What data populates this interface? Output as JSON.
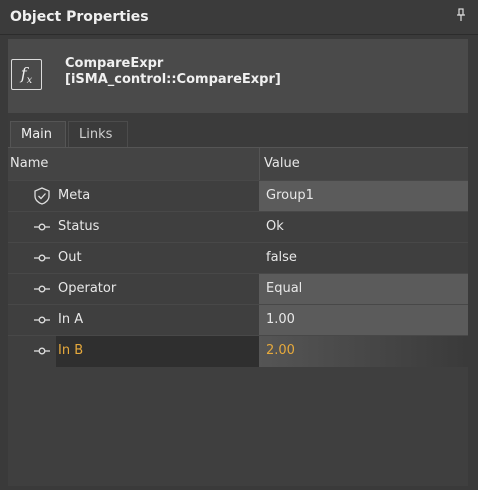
{
  "panel": {
    "title": "Object Properties"
  },
  "component": {
    "name": "CompareExpr",
    "type": "[iSMA_control::CompareExpr]"
  },
  "tabs": [
    {
      "label": "Main",
      "active": true
    },
    {
      "label": "Links",
      "active": false
    }
  ],
  "columns": {
    "name": "Name",
    "value": "Value"
  },
  "rows": [
    {
      "name": "Meta",
      "value": "Group1",
      "icon": "shield-icon"
    },
    {
      "name": "Status",
      "value": "Ok",
      "icon": "slot-icon"
    },
    {
      "name": "Out",
      "value": "false",
      "icon": "slot-icon"
    },
    {
      "name": "Operator",
      "value": "Equal",
      "icon": "slot-icon"
    },
    {
      "name": "In A",
      "value": "1.00",
      "icon": "slot-icon"
    },
    {
      "name": "In B",
      "value": "2.00",
      "icon": "slot-icon",
      "selected": true
    }
  ],
  "colors": {
    "selected_text": "#e6a93c",
    "background": "#3a3a3a"
  }
}
